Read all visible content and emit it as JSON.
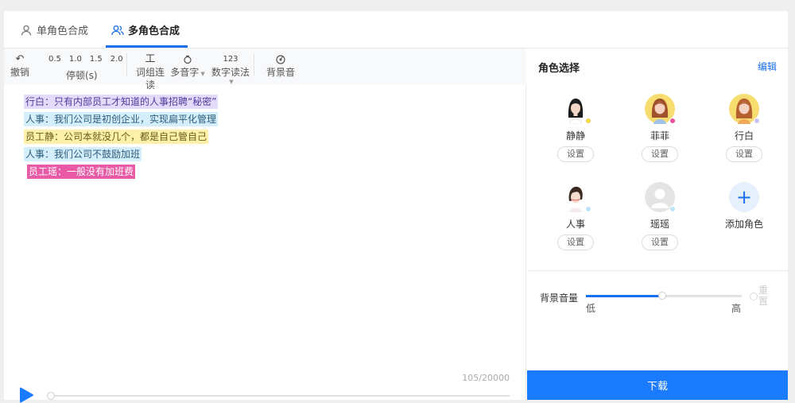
{
  "tabs": [
    {
      "label": "单角色合成",
      "icon": "user-icon",
      "active": false
    },
    {
      "label": "多角色合成",
      "icon": "users-icon",
      "active": true
    }
  ],
  "toolbar": {
    "undo": {
      "glyph": "↶",
      "label": "撤销"
    },
    "speeds": [
      "0.5",
      "1.0",
      "1.5",
      "2.0"
    ],
    "pause_label": "停顿(s)",
    "word_group": {
      "glyph": "工",
      "label": "词组连读"
    },
    "polyphone": {
      "label": "多音字"
    },
    "number_reading": {
      "glyph": "123",
      "label": "数字读法"
    },
    "bg_music": {
      "label": "背景音"
    }
  },
  "script_lines": [
    {
      "text": "行白：只有内部员工才知道的人事招聘“秘密”",
      "color": "purple"
    },
    {
      "text": "人事：我们公司是初创企业，实现扁平化管理",
      "color": "blue"
    },
    {
      "text": "员工静：公司本就没几个，都是自己管自己",
      "color": "yellow"
    },
    {
      "text": "人事：我们公司不鼓励加班",
      "color": "blue"
    },
    {
      "text": "员工瑶：一般没有加班费",
      "color": "pink"
    }
  ],
  "char_counter": "105/20000",
  "roles_panel": {
    "title": "角色选择",
    "edit_label": "编辑",
    "roles": [
      {
        "name": "静静",
        "set_label": "设置",
        "status_color": "#f6d54a"
      },
      {
        "name": "菲菲",
        "set_label": "设置",
        "status_color": "#e8519c"
      },
      {
        "name": "行白",
        "set_label": "设置",
        "status_color": "#c9c2f2"
      },
      {
        "name": "人事",
        "set_label": "设置",
        "status_color": "#bde4fb"
      },
      {
        "name": "瑶瑶",
        "set_label": "设置",
        "status_color": "#bde4fb"
      }
    ],
    "add_label": "添加角色"
  },
  "volume": {
    "label": "背景音量",
    "low": "低",
    "high": "高",
    "reset": "重置",
    "level_percent": 49
  },
  "download_label": "下载",
  "colors": {
    "accent": "#1a6ff0",
    "download_bg": "#1a7bff"
  }
}
